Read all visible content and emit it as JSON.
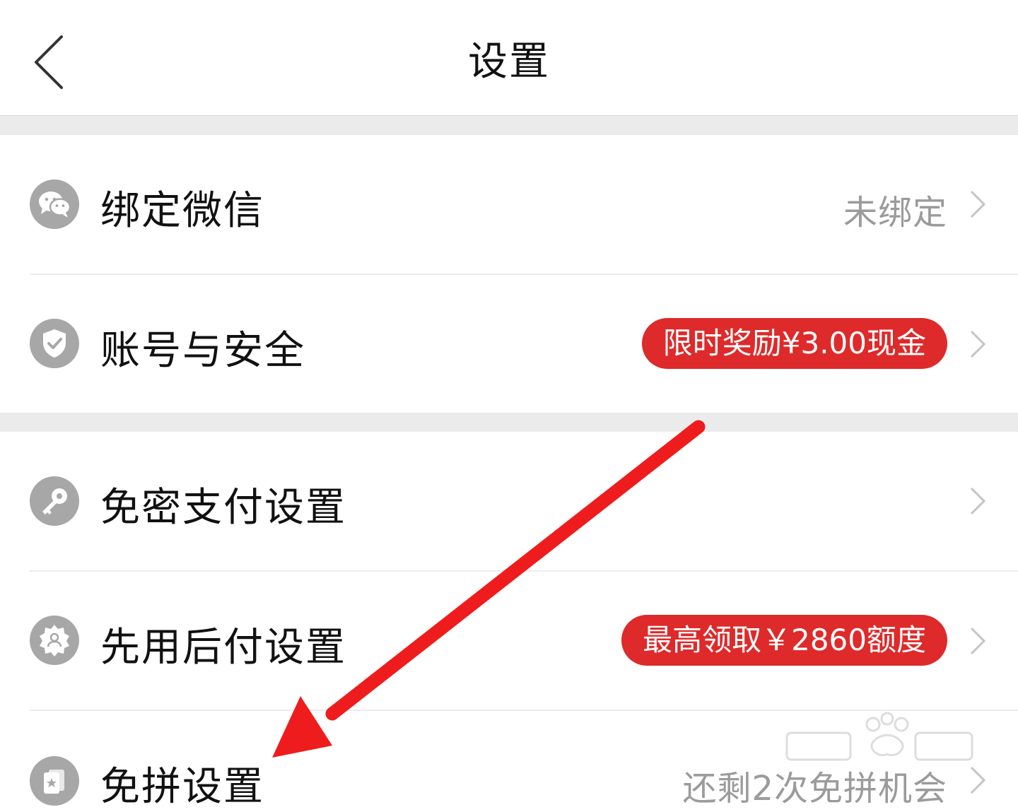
{
  "header": {
    "title": "设置"
  },
  "sections": [
    {
      "items": [
        {
          "label": "绑定微信",
          "value": "未绑定",
          "icon": "wechat-icon"
        },
        {
          "label": "账号与安全",
          "badge": "限时奖励¥3.00现金",
          "icon": "shield-check-icon"
        }
      ]
    },
    {
      "items": [
        {
          "label": "免密支付设置",
          "icon": "key-icon"
        },
        {
          "label": "先用后付设置",
          "badge": "最高领取￥2860额度",
          "icon": "badge-person-icon"
        },
        {
          "label": "免拼设置",
          "value": "还剩2次免拼机会",
          "icon": "card-star-icon"
        }
      ]
    }
  ],
  "colors": {
    "badge": "#de2a2a",
    "icon_bg": "#a7a7a7",
    "secondary_text": "#9b9b9b",
    "gap": "#ebebeb",
    "annotation_arrow": "#ee1c1c"
  }
}
